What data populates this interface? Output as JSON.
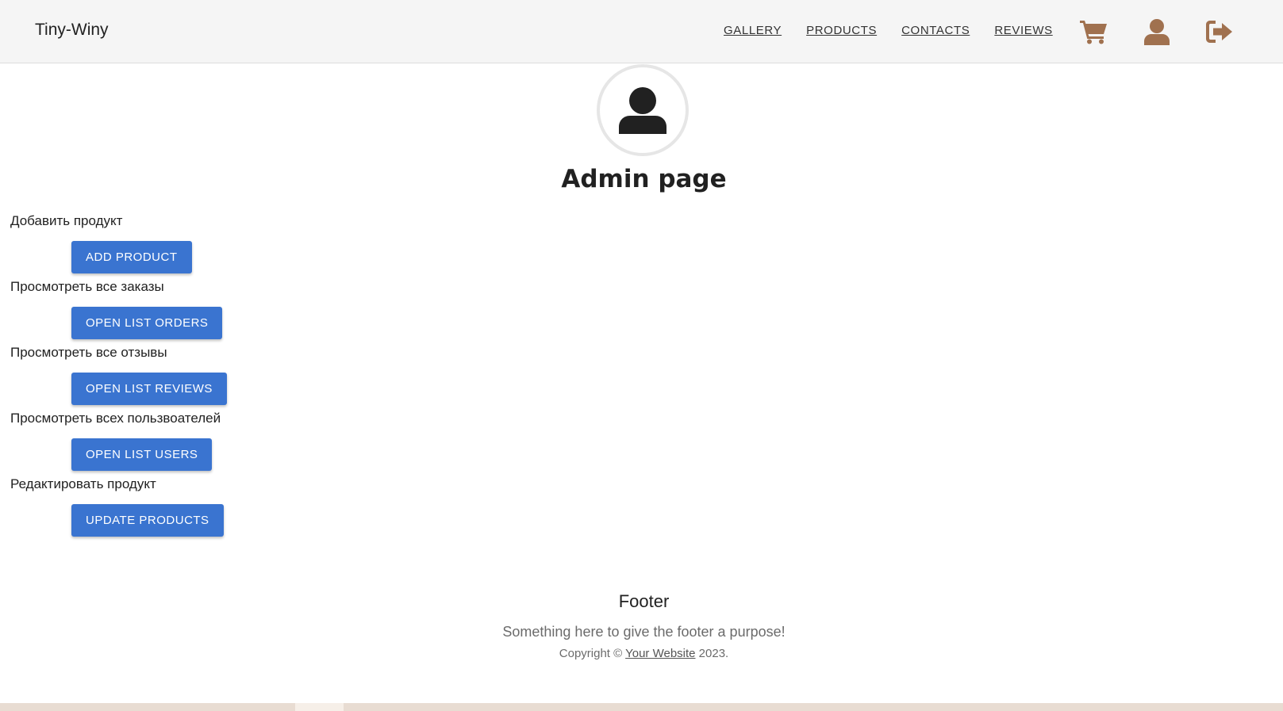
{
  "navbar": {
    "brand": "Tiny-Winy",
    "links": [
      "GALLERY",
      "PRODUCTS",
      "CONTACTS",
      "REVIEWS"
    ],
    "icons": [
      "cart-icon",
      "user-icon",
      "logout-icon"
    ],
    "icon_color": "#a0714f"
  },
  "main": {
    "avatar_icon": "user-icon",
    "title": "Admin page",
    "sections": [
      {
        "label": "Добавить продукт",
        "button": "ADD PRODUCT"
      },
      {
        "label": "Просмотреть все заказы",
        "button": "OPEN LIST ORDERS"
      },
      {
        "label": "Просмотреть все отзывы",
        "button": "OPEN LIST REVIEWS"
      },
      {
        "label": "Просмотреть всех пользвоателей",
        "button": "OPEN LIST USERS"
      },
      {
        "label": "Редактировать продукт",
        "button": "UPDATE PRODUCTS"
      }
    ],
    "button_color": "#3a74d0"
  },
  "footer": {
    "title": "Footer",
    "text": "Something here to give the footer a purpose!",
    "copy_prefix": "Copyright © ",
    "copy_link": "Your Website",
    "copy_suffix": " 2023."
  }
}
